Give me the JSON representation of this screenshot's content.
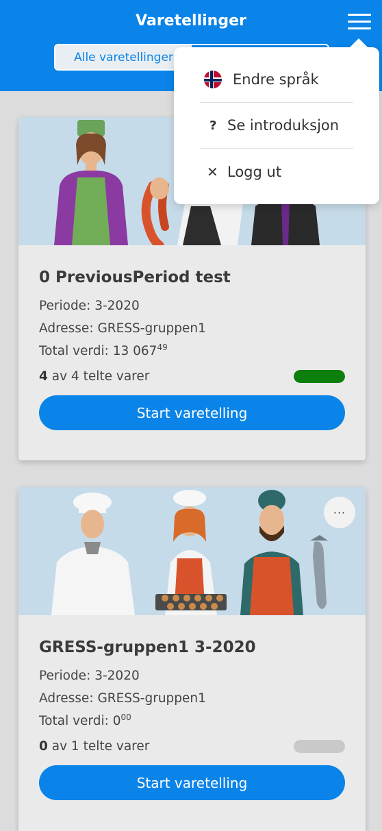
{
  "header": {
    "title": "Varetellinger",
    "tabs": [
      {
        "label": "Alle varetellinger",
        "active": true
      },
      {
        "label": "",
        "active": false
      }
    ]
  },
  "menu": {
    "items": [
      {
        "label": "Endre språk",
        "icon": "norway-flag-icon"
      },
      {
        "label": "Se introduksjon",
        "icon": "question-icon",
        "glyph": "?"
      },
      {
        "label": "Logg ut",
        "icon": "close-icon",
        "glyph": "✕"
      }
    ]
  },
  "cards": [
    {
      "title": "0 PreviousPeriod test",
      "period_label": "Periode:",
      "period": "3-2020",
      "address_label": "Adresse:",
      "address": "GRESS-gruppen1",
      "total_label": "Total verdi:",
      "total_main": "13 067",
      "total_decimals": "49",
      "counted": "4",
      "count_rest": "av 4 telte varer",
      "progress": 1.0,
      "button_label": "Start varetelling",
      "more_label": "···"
    },
    {
      "title": "GRESS-gruppen1 3-2020",
      "period_label": "Periode:",
      "period": "3-2020",
      "address_label": "Adresse:",
      "address": "GRESS-gruppen1",
      "total_label": "Total verdi:",
      "total_main": "0",
      "total_decimals": "00",
      "counted": "0",
      "count_rest": "av 1 telte varer",
      "progress": 0.0,
      "button_label": "Start varetelling",
      "more_label": "···"
    }
  ],
  "colors": {
    "accent": "#0a84e8",
    "progress_complete": "#0c7f0c",
    "progress_empty": "#c9c9c9"
  }
}
